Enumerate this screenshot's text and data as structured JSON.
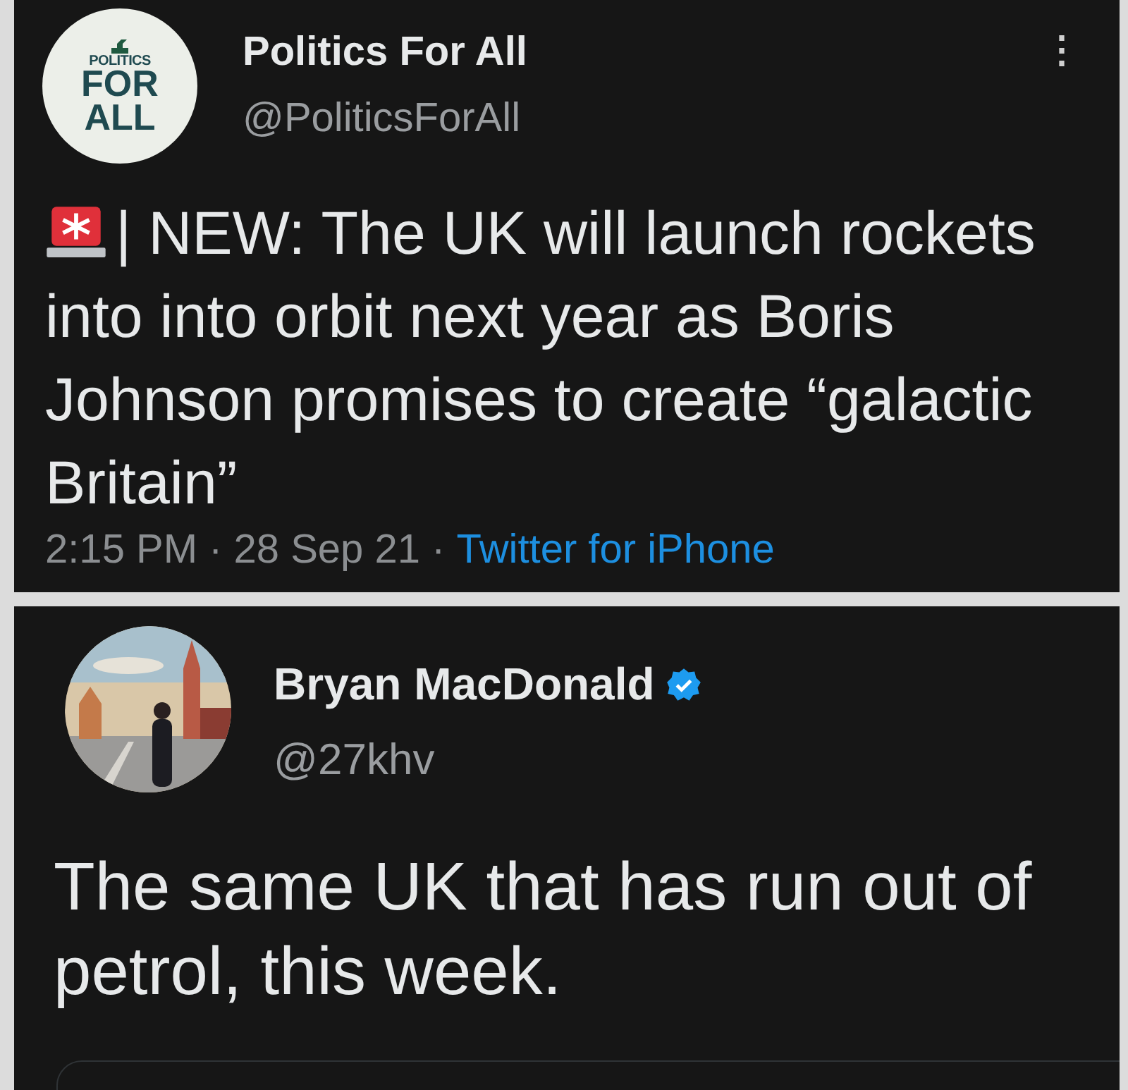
{
  "tweets": [
    {
      "author": {
        "name": "Politics For All",
        "handle": "@PoliticsForAll",
        "verified": false,
        "avatar": {
          "kind": "logo",
          "lines": [
            "POLITICS",
            "FOR",
            "ALL"
          ]
        }
      },
      "menu": "⋮",
      "alert_icon": true,
      "text": "| NEW: The UK will launch rockets into into orbit next year as Boris Johnson promises to create “galactic Britain”",
      "meta": {
        "timestamp": "2:15 PM · 28 Sep 21 ·",
        "source": "Twitter for iPhone"
      }
    },
    {
      "author": {
        "name": "Bryan MacDonald",
        "handle": "@27khv",
        "verified": true
      },
      "alert_icon": false,
      "text": "The same UK that has run out of petrol, this week.",
      "quoted_card": true
    }
  ]
}
